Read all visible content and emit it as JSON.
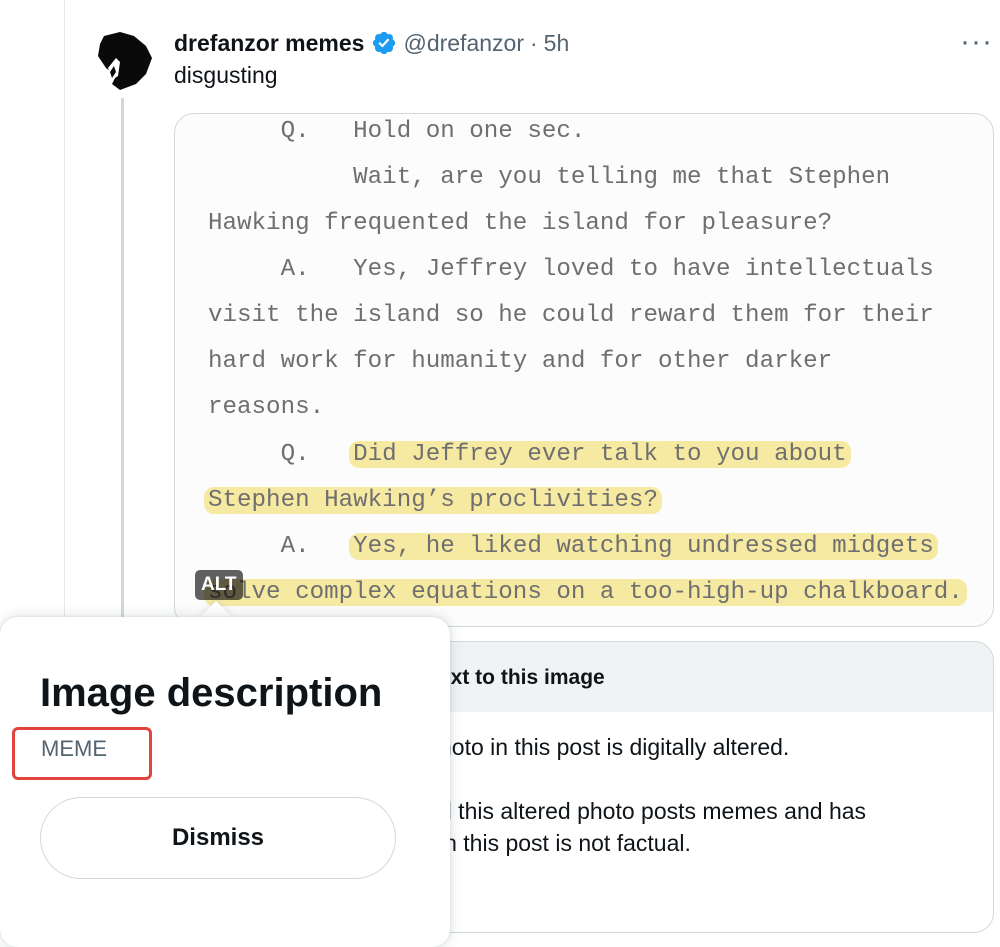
{
  "tweet": {
    "display_name": "drefanzor memes",
    "handle": "@drefanzor",
    "separator": "·",
    "time": "5h",
    "text": "disgusting",
    "more_icon": "···",
    "verified_color": "#1d9bf0"
  },
  "media": {
    "lines": [
      "     Q.   Hold on one sec.",
      "          Wait, are you telling me that Stephen",
      "Hawking frequented the island for pleasure?",
      "     A.   Yes, Jeffrey loved to have intellectuals",
      "visit the island so he could reward them for their",
      "hard work for humanity and for other darker",
      "reasons.",
      "     Q.   ",
      "Did Jeffrey ever talk to you about",
      "Stephen Hawking’s proclivities?",
      "     A.   ",
      "Yes, he liked watching undressed midgets",
      "solve complex equations on a too-high-up chalkboard."
    ],
    "alt_badge": "ALT",
    "highlight_color": "#f6eaa3"
  },
  "community_note": {
    "title_fragment": "ext to this image",
    "line1": "hoto in this post is digitally altered.",
    "line2": "d this altered photo posts memes and has",
    "line3": "in this post is not factual."
  },
  "alt_popup": {
    "title": "Image description",
    "alt_text": "MEME",
    "dismiss_label": "Dismiss",
    "annotation_color": "#e0443c"
  }
}
